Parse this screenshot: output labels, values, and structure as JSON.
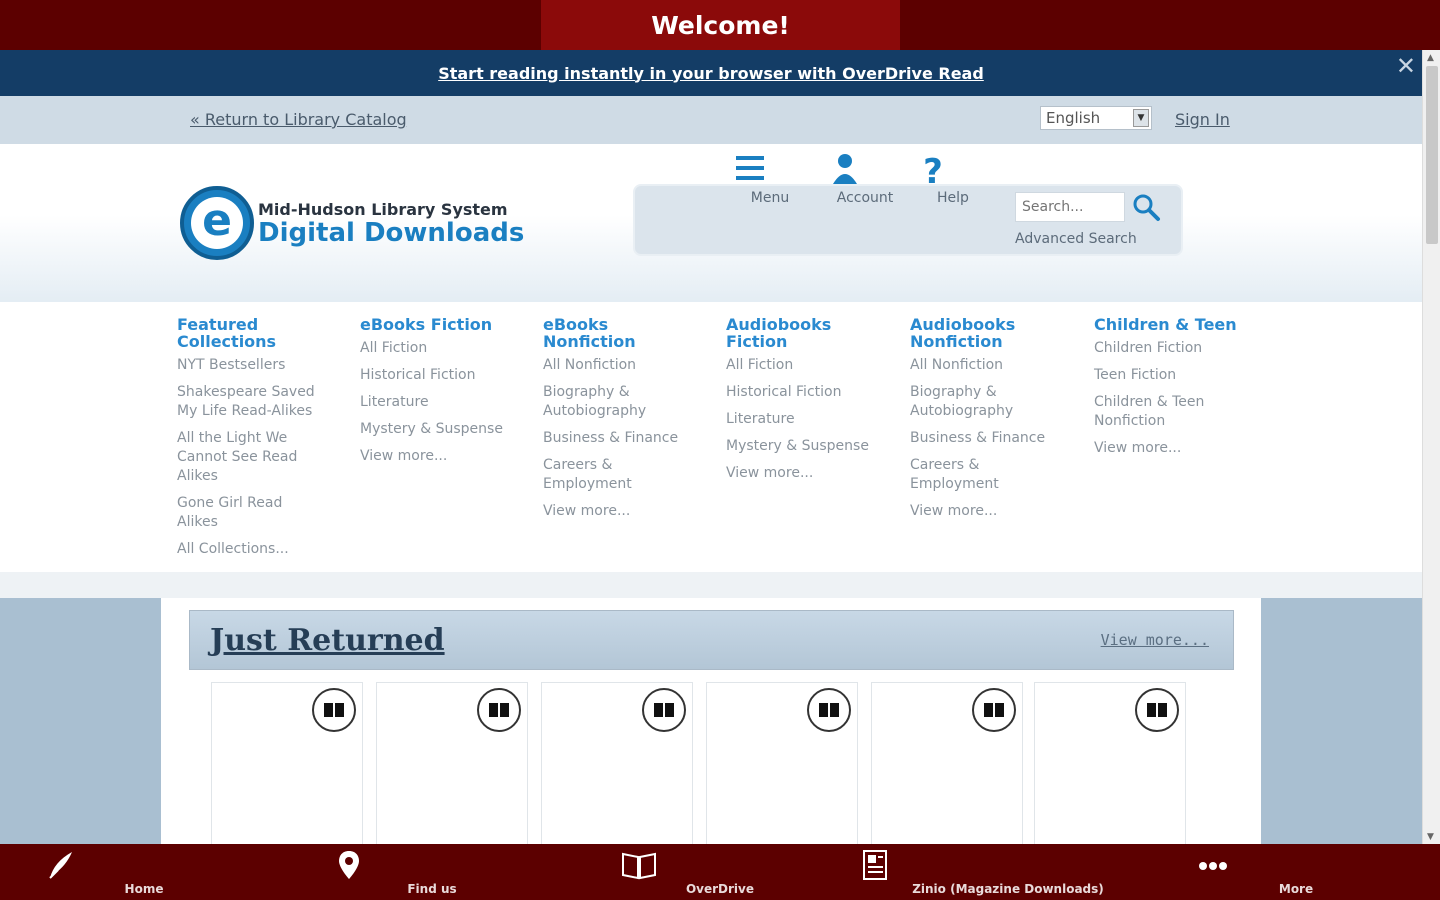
{
  "app_bar": {
    "title": "Welcome!"
  },
  "promo": {
    "text": "Start reading instantly in your browser with OverDrive Read",
    "close": "✕"
  },
  "utility": {
    "return_link": "« Return to Library Catalog",
    "language": "English",
    "sign_in": "Sign In"
  },
  "logo": {
    "line1": "Mid-Hudson Library System",
    "line2": "Digital Downloads",
    "mark": "e"
  },
  "toolbar": {
    "menu": "Menu",
    "account": "Account",
    "help": "Help",
    "search_placeholder": "Search...",
    "advanced_search": "Advanced Search"
  },
  "categories": [
    {
      "title": "Featured Collections",
      "links": [
        "NYT Bestsellers",
        "Shakespeare Saved My Life Read-Alikes",
        "All the Light We Cannot See Read Alikes",
        "Gone Girl Read Alikes",
        "All Collections..."
      ]
    },
    {
      "title": "eBooks Fiction",
      "links": [
        "All Fiction",
        "Historical Fiction",
        "Literature",
        "Mystery & Suspense",
        "View more..."
      ]
    },
    {
      "title": "eBooks Nonfiction",
      "links": [
        "All Nonfiction",
        "Biography & Autobiography",
        "Business & Finance",
        "Careers & Employment",
        "View more..."
      ]
    },
    {
      "title": "Audiobooks Fiction",
      "links": [
        "All Fiction",
        "Historical Fiction",
        "Literature",
        "Mystery & Suspense",
        "View more..."
      ]
    },
    {
      "title": "Audiobooks Nonfiction",
      "links": [
        "All Nonfiction",
        "Biography & Autobiography",
        "Business & Finance",
        "Careers & Employment",
        "View more..."
      ]
    },
    {
      "title": "Children & Teen",
      "links": [
        "Children Fiction",
        "Teen Fiction",
        "Children & Teen Nonfiction",
        "View more..."
      ]
    }
  ],
  "just_returned": {
    "title": "Just Returned",
    "view_more": "View more..."
  },
  "tabs": {
    "home": "Home",
    "find_us": "Find us",
    "overdrive": "OverDrive",
    "zinio": "Zinio (Magazine Downloads)",
    "more": "More"
  },
  "colors": {
    "app_bar": "#5c0000",
    "title_box": "#8b0a0a",
    "promo_bg": "#143d66",
    "link_blue": "#2a8ad0",
    "brand_blue": "#1a7fc1"
  }
}
